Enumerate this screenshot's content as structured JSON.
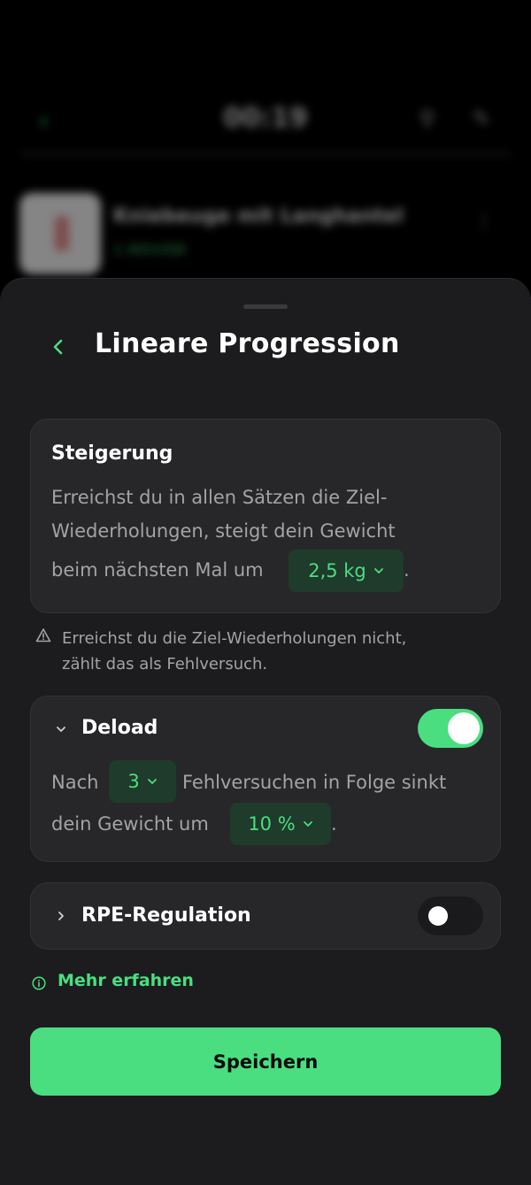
{
  "background": {
    "timer": "00:19",
    "exercise_name": "Kniebeuge mit Langhantel",
    "exercise_meta": "1 Aktivität"
  },
  "sheet": {
    "title": "Lineare Progression"
  },
  "steigerung": {
    "heading": "Steigerung",
    "line1": "Erreichst du in allen Sätzen die Ziel-",
    "line2": "Wiederholungen, steigt dein Gewicht",
    "line3": "beim nächsten Mal um",
    "increment": "2,5 kg",
    "trailing": "."
  },
  "warning": {
    "line1": "Erreichst du die Ziel-Wiederholungen nicht,",
    "line2": "zählt das als Fehlversuch."
  },
  "deload": {
    "label": "Deload",
    "enabled": true,
    "prefix": "Nach",
    "failures": "3",
    "middle": "Fehlversuchen in Folge sinkt",
    "line2_prefix": "dein Gewicht um",
    "percent": "10 %",
    "trailing": "."
  },
  "rpe": {
    "label": "RPE-Regulation",
    "enabled": false
  },
  "learn_more": "Mehr erfahren",
  "save_label": "Speichern",
  "colors": {
    "accent": "#4ade80",
    "sheet": "#1c1c1f",
    "card": "#27272a",
    "pill_bg": "#1f3b2b"
  }
}
